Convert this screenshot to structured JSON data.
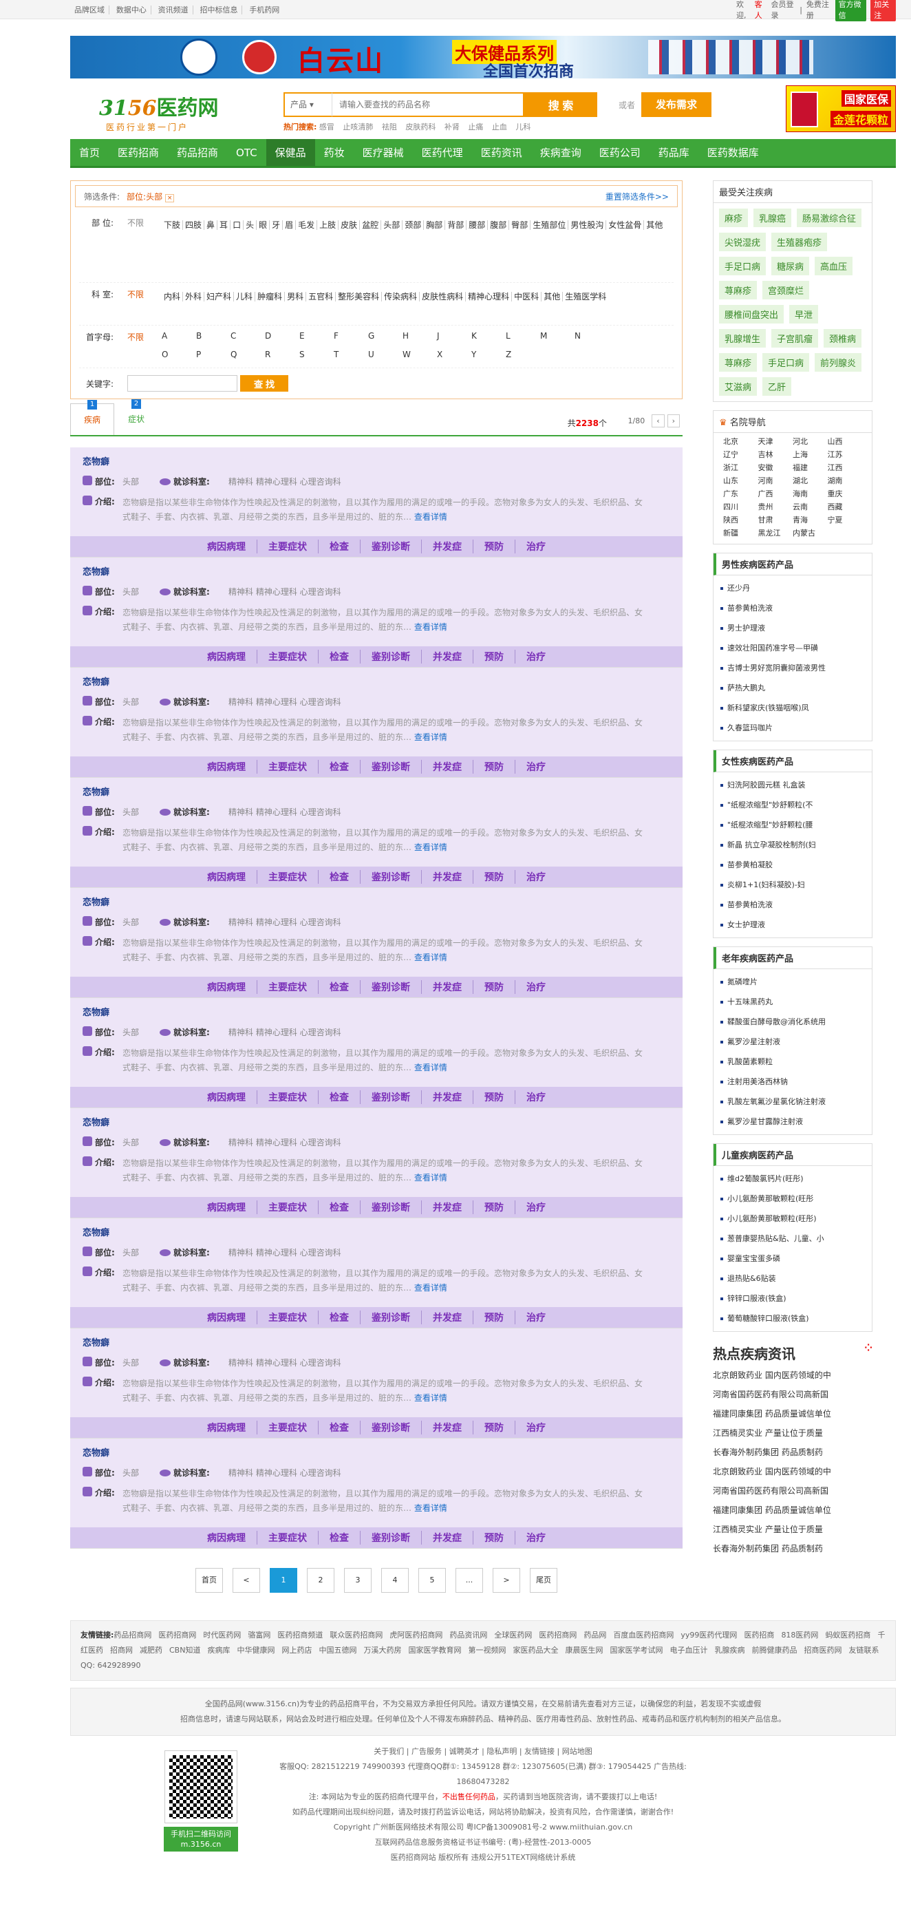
{
  "topbar": {
    "links": [
      "品牌区域",
      "数据中心",
      "资讯频道",
      "招中标信息",
      "手机药网"
    ],
    "welcome": "欢迎,",
    "guest": "客人",
    "login": "会员登录",
    "register": "免费注册",
    "wechat": "官方微信",
    "weibo": "加关注"
  },
  "banner": {
    "title": "白云山",
    "sub1": "大保健品系列",
    "sub2": "全国首次招商"
  },
  "header": {
    "logo_num1": "31",
    "logo_num2": "56",
    "logo_cn": "医药网",
    "slogan": "医药行业第一门户",
    "search_type": "产品",
    "search_placeholder": "请输入要查找的药品名称",
    "search_btn": "搜 索",
    "or": "或者",
    "publish": "发布需求",
    "hot_label": "热门搜索:",
    "hot": [
      "感冒",
      "止咳清肺",
      "祛阻",
      "皮肤药科",
      "补肾",
      "止痛",
      "止血",
      "儿科"
    ],
    "ad_t1": "国家医保",
    "ad_t2": "金莲花颗粒"
  },
  "nav": [
    "首页",
    "医药招商",
    "药品招商",
    "OTC",
    "保健品",
    "药妆",
    "医疗器械",
    "医药代理",
    "医药资讯",
    "疾病查询",
    "医药公司",
    "药品库",
    "医药数据库"
  ],
  "nav_current": 4,
  "filter": {
    "label": "筛选条件:",
    "cond": "部位:头部",
    "reset": "重置筛选条件>>",
    "part_k": "部 位:",
    "part_all": "不限",
    "parts": [
      "下肢",
      "四肢",
      "鼻",
      "耳",
      "口",
      "头",
      "眼",
      "牙",
      "眉",
      "毛发",
      "上肢",
      "皮肤",
      "盆腔",
      "头部",
      "颈部",
      "胸部",
      "背部",
      "腰部",
      "腹部",
      "臀部",
      "生殖部位",
      "男性股沟",
      "女性盆骨",
      "其他"
    ],
    "dept_k": "科 室:",
    "dept_all": "不限",
    "depts": [
      "内科",
      "外科",
      "妇产科",
      "儿科",
      "肿瘤科",
      "男科",
      "五官科",
      "整形美容科",
      "传染病科",
      "皮肤性病科",
      "精神心理科",
      "中医科",
      "其他",
      "生殖医学科"
    ],
    "letter_k": "首字母:",
    "letter_all": "不限",
    "letters": [
      "A",
      "B",
      "C",
      "D",
      "E",
      "F",
      "G",
      "H",
      "J",
      "K",
      "L",
      "M",
      "N",
      "O",
      "P",
      "Q",
      "R",
      "S",
      "T",
      "U",
      "W",
      "X",
      "Y",
      "Z"
    ],
    "kw_k": "关键字:",
    "kw_btn": "查 找"
  },
  "tabs": [
    {
      "label": "疾病",
      "n": "1"
    },
    {
      "label": "症状",
      "n": "2"
    }
  ],
  "count_pre": "共",
  "count": "2238",
  "count_post": "个",
  "pager": "1/80",
  "item": {
    "name": "恋物癖",
    "part_lbl": "部位:",
    "part_val": "头部",
    "dept_lbl": "就诊科室:",
    "dept_val": "精神科  精神心理科  心理咨询科",
    "intro_lbl": "介绍:",
    "intro": "恋物癖是指以某些非生命物体作为性唤起及性满足的刺激物，且以其作为履用的满足的或唯一的手段。恋物对象多为女人的头发、毛织织品、女式鞋子、手套、内衣裤、乳罩、月经带之类的东西，且多半是用过的、脏的东",
    "more": "查看详情",
    "bar": [
      "病因病理",
      "主要症状",
      "检查",
      "鉴别诊断",
      "并发症",
      "预防",
      "治疗"
    ]
  },
  "pages": [
    "首页",
    "<",
    "1",
    "2",
    "3",
    "4",
    "5",
    "...",
    ">",
    "尾页"
  ],
  "right": {
    "focus_title": "最受关注疾病",
    "focus": [
      "麻疹",
      "乳腺癌",
      "肠易激综合征",
      "尖锐湿疣",
      "生殖器疱疹",
      "手足口病",
      "糖尿病",
      "高血压",
      "荨麻疹",
      "宫颈糜烂",
      "腰椎间盘突出",
      "早泄",
      "乳腺增生",
      "子宫肌瘤",
      "颈椎病",
      "荨麻疹",
      "手足口病",
      "前列腺炎",
      "艾滋病",
      "乙肝"
    ],
    "famous_title": "名院导航",
    "provs": [
      "北京",
      "天津",
      "河北",
      "山西",
      "辽宁",
      "吉林",
      "上海",
      "江苏",
      "浙江",
      "安徽",
      "福建",
      "江西",
      "山东",
      "河南",
      "湖北",
      "湖南",
      "广东",
      "广西",
      "海南",
      "重庆",
      "四川",
      "贵州",
      "云南",
      "西藏",
      "陕西",
      "甘肃",
      "青海",
      "宁夏",
      "新疆",
      "黑龙江",
      "内蒙古"
    ],
    "male_title": "男性疾病医药产品",
    "male": [
      "还少丹",
      "苗参黄柏洗液",
      "男士护理液",
      "速效壮阳国药准字号—甲磺",
      "吉博士男好宽阴囊抑菌液男性",
      "萨热大鹏丸",
      "新科望家庆(铁猫咽喉)凤",
      "久春篮玛咖片"
    ],
    "female_title": "女性疾病医药产品",
    "female": [
      "妇洗阿胶圆元糕 礼盒装",
      "\"纸棍浓缩型\"妙舒颗粒(不",
      "\"纸棍浓缩型\"妙舒颗粒(腰",
      "新晶 抗立孕凝胶栓制剂(妇",
      "苗参黄柏凝胶",
      "炎柳1+1(妇科凝胶)-妇",
      "苗参黄柏洗液",
      "女士护理液"
    ],
    "old_title": "老年疾病医药产品",
    "old": [
      "氮磷喹片",
      "十五味黑药丸",
      "鞣酸蛋白酵母散@消化系统用",
      "氟罗沙星注射液",
      "乳酸菌素颗粒",
      "注射用美洛西林钠",
      "乳酸左氧氟沙星氯化钠注射液",
      "氟罗沙星甘露醇注射液"
    ],
    "child_title": "儿童疾病医药产品",
    "child": [
      "维d2葡酸氯钙片(旺彤)",
      "小儿氨酚黄那敏颗粒(旺彤",
      "小儿氨酚黄那敏颗粒(旺彤)",
      "葱普康婴热贴&贴、儿童、小",
      "婴童宝宝蛋多磷",
      "退热贴&6贴装",
      "锌锌口服液(铁盒)",
      "葡萄糖酸锌口服液(铁盒)"
    ],
    "hot_title": "热点疾病资讯",
    "hot": [
      "北京朗致药业 国内医药领域的中",
      "河南省国药医药有限公司高新国",
      "福建同康集团 药品质量诚信单位",
      "江西楠灵实业 产量让位于质量",
      "长春海外制药集团 药品质制药",
      "北京朗致药业 国内医药领域的中",
      "河南省国药医药有限公司高新国",
      "福建同康集团 药品质量诚信单位",
      "江西楠灵实业 产量让位于质量",
      "长春海外制药集团 药品质制药"
    ]
  },
  "footer": {
    "links_label": "友情链接:",
    "links": [
      "药品招商网",
      "医药招商网",
      "时代医药网",
      "骆富网",
      "医药招商频道",
      "联众医药招商网",
      "虎阿医药招商网",
      "药品资讯网",
      "全球医药网",
      "医药招商网",
      "药品网",
      "百度血医药招商网",
      "yy99医药代理网",
      "医药招商",
      "818医药网",
      "蚂蚁医药招商",
      "千红医药",
      "招商网",
      "减肥药",
      "CBN知道",
      "疾病库",
      "中华健康网",
      "网上药店",
      "中国五德网",
      "万溪大药房",
      "国家医学教育网",
      "第一视频网",
      "家医药品大全",
      "康晨医生网",
      "国家医学考试网",
      "电子血压计",
      "乳腺疾病",
      "前腾健康药品",
      "招商医药网",
      "友链联系QQ: 642928990"
    ],
    "disclaim1": "全国药品网(www.3156.cn)为专业的药品招商平台，不为交易双方承担任何风险。请双方谨慎交易，在交易前请先查看对方三证，以确保您的利益，若发现不实或虚假",
    "disclaim2": "招商信息时，请速与网站联系，网站会及时进行相应处理。任何单位及个人不得发布麻醉药品、精神药品、医疗用毒性药品、放射性药品、戒毒药品和医疗机构制剂的相关产品信息。",
    "qr_label": "手机扫二维码访问\nm.3156.cn",
    "line1": "关于我们 | 广告服务 | 诚聘英才 | 隐私声明 | 友情链接 | 网站地图",
    "line2": "客服QQ: 2821512219  749900393    代理商QQ群①: 13459128  群②: 123075605(已满)  群③: 179054425  广告热线: 18680473282",
    "line3a": "注: 本网站为专业的医药招商代理平台，",
    "line3b": "不出售任何药品",
    "line3c": "，买药请到当地医院咨询，请不要拨打以上电话!",
    "line4": "如药品代理期间出现纠纷问题，请及时拨打药监诉讼电话，网站将协助解决，投资有风险，合作需谨慎，谢谢合作!",
    "line5": "Copyright 广州新医网络技术有限公司  粤ICP备13009081号-2  www.miithuian.gov.cn",
    "line6": "互联网药品信息服务资格证书证书编号: (粤)-经营性-2013-0005",
    "line7": "医药招商网站  版权所有  违规公开51TEXT网络统计系统"
  }
}
